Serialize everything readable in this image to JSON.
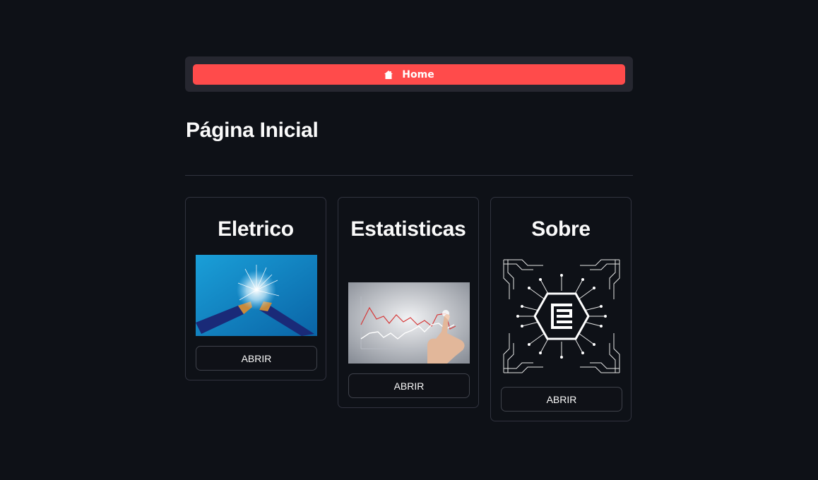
{
  "nav": {
    "home_label": "Home",
    "home_icon": "house-icon",
    "accent_color": "#ff4b4b"
  },
  "page": {
    "title": "Página Inicial"
  },
  "cards": [
    {
      "title": "Eletrico",
      "button_label": "ABRIR",
      "image": "broken-electric-cable-sparks"
    },
    {
      "title": "Estatisticas",
      "button_label": "ABRIR",
      "image": "hand-pointing-at-line-chart"
    },
    {
      "title": "Sobre",
      "button_label": "ABRIR",
      "image": "circuit-chip-logo"
    }
  ]
}
